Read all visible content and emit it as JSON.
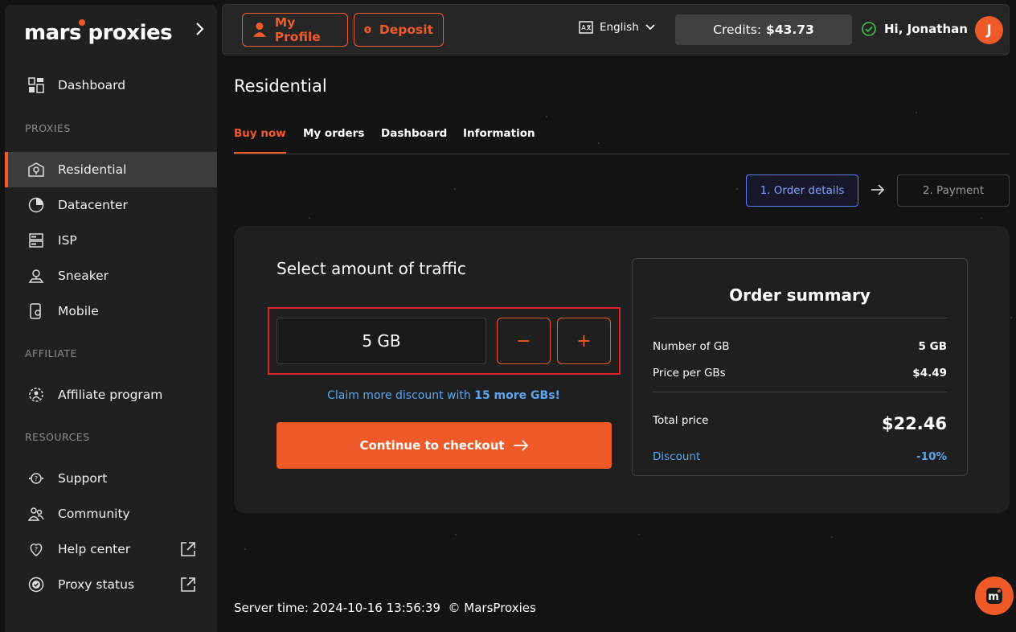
{
  "sidebar": {
    "logo_left": "mars",
    "logo_right": "proxies",
    "items": [
      {
        "label": "Dashboard",
        "icon": "dashboard-icon"
      },
      {
        "label": "Residential",
        "icon": "location-pin-icon",
        "active": true
      },
      {
        "label": "Datacenter",
        "icon": "pie-icon"
      },
      {
        "label": "ISP",
        "icon": "server-icon"
      },
      {
        "label": "Sneaker",
        "icon": "sneaker-pin-icon"
      },
      {
        "label": "Mobile",
        "icon": "mobile-icon"
      },
      {
        "label": "Affiliate program",
        "icon": "affiliate-icon"
      },
      {
        "label": "Support",
        "icon": "support-icon"
      },
      {
        "label": "Community",
        "icon": "community-icon"
      },
      {
        "label": "Help center",
        "icon": "help-icon"
      },
      {
        "label": "Proxy status",
        "icon": "status-icon"
      }
    ],
    "sections": {
      "proxies": "PROXIES",
      "affiliate": "AFFILIATE",
      "resources": "RESOURCES"
    }
  },
  "topbar": {
    "my_profile": "My Profile",
    "deposit": "Deposit",
    "language": "English",
    "credits_label": "Credits:",
    "credits_value": "$43.73",
    "greeting": "Hi, Jonathan",
    "avatar_initial": "J"
  },
  "main": {
    "title": "Residential",
    "tabs": [
      "Buy now",
      "My orders",
      "Dashboard",
      "Information"
    ],
    "steps": [
      "1. Order details",
      "2. Payment"
    ],
    "traffic_title": "Select amount of traffic",
    "quantity": "5 GB",
    "minus": "−",
    "plus": "+",
    "claim_prefix": "Claim more discount with",
    "claim_highlight": "15 more GBs!",
    "checkout": "Continue to checkout"
  },
  "summary": {
    "title": "Order summary",
    "rows": [
      {
        "label": "Number of GB",
        "value": "5 GB"
      },
      {
        "label": "Price per GBs",
        "value": "$4.49"
      }
    ],
    "total_label": "Total price",
    "total_value": "$22.46",
    "discount_label": "Discount",
    "discount_value": "-10%"
  },
  "footer": {
    "server_time": "Server time: 2024-10-16 13:56:39",
    "copyright": "© MarsProxies"
  },
  "colors": {
    "accent": "#f05a28",
    "link": "#5aa6f0",
    "step_active": "#5a7cff"
  }
}
